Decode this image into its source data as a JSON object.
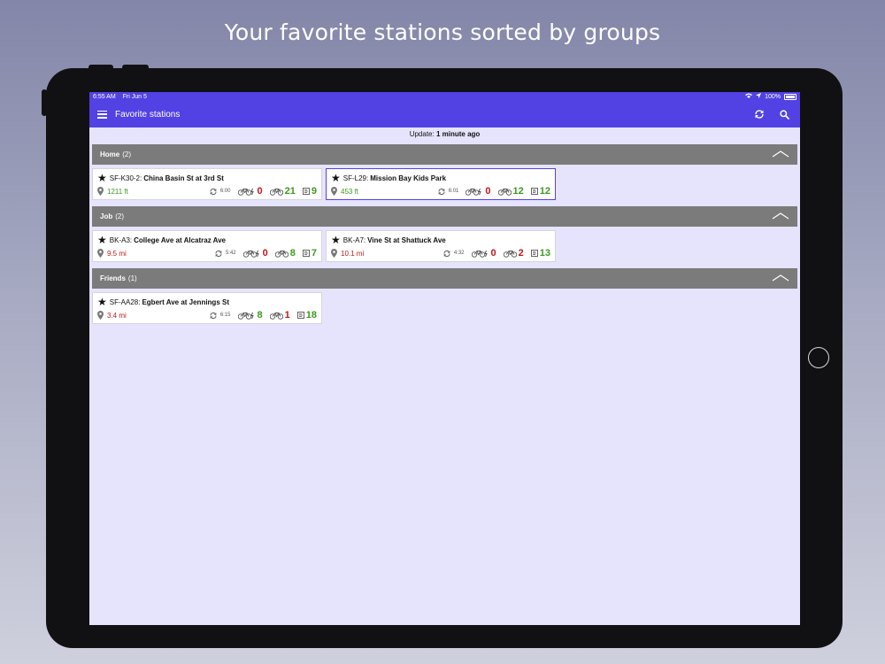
{
  "caption": "Your favorite stations sorted by groups",
  "status_bar": {
    "time": "6:55 AM",
    "date": "Fri Jun 5",
    "battery": "100%"
  },
  "toolbar": {
    "title": "Favorite stations"
  },
  "update": {
    "label": "Update:",
    "value": "1 minute ago"
  },
  "groups": [
    {
      "name": "Home",
      "count": "(2)",
      "stations": [
        {
          "code": "SF-K30-2:",
          "name": "China Basin St at 3rd St",
          "distance": "1211 ft",
          "distance_status": "near",
          "time": "6:00",
          "ebikes": "0",
          "bikes": "21",
          "docks": "9"
        },
        {
          "code": "SF-L29:",
          "name": "Mission Bay Kids Park",
          "distance": "453 ft",
          "distance_status": "near",
          "time": "6:01",
          "ebikes": "0",
          "bikes": "12",
          "docks": "12"
        }
      ]
    },
    {
      "name": "Job",
      "count": "(2)",
      "stations": [
        {
          "code": "BK-A3:",
          "name": "College Ave at Alcatraz Ave",
          "distance": "9.5 mi",
          "distance_status": "far",
          "time": "5:42",
          "ebikes": "0",
          "bikes": "8",
          "docks": "7"
        },
        {
          "code": "BK-A7:",
          "name": "Vine St at Shattuck Ave",
          "distance": "10.1 mi",
          "distance_status": "far",
          "time": "4:32",
          "ebikes": "0",
          "bikes": "2",
          "docks": "13"
        }
      ]
    },
    {
      "name": "Friends",
      "count": "(1)",
      "stations": [
        {
          "code": "SF-AA28:",
          "name": "Egbert Ave at Jennings St",
          "distance": "3.4 mi",
          "distance_status": "far",
          "time": "6:15",
          "ebikes": "8",
          "bikes": "1",
          "docks": "18"
        }
      ]
    }
  ],
  "icons": {
    "menu": "hamburger-icon",
    "refresh": "refresh-icon",
    "search": "search-icon",
    "favorite": "star-icon",
    "location": "pin-icon",
    "ebike": "ebike-icon",
    "bike": "bike-icon",
    "dock": "dock-icon",
    "collapse": "chevron-up-icon"
  },
  "colors": {
    "accent": "#5242e4",
    "background": "#e6e3fd",
    "group_header": "#7b7b7b",
    "good": "#3c9a1e",
    "bad": "#c01818"
  }
}
